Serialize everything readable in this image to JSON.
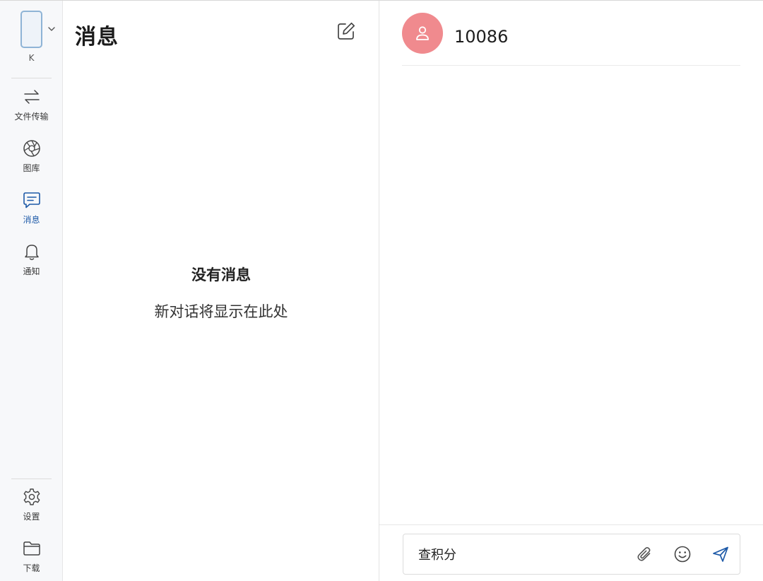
{
  "rail": {
    "device_label": "K",
    "items": [
      {
        "label": "文件传输",
        "icon": "transfer-arrows-icon"
      },
      {
        "label": "图库",
        "icon": "aperture-icon"
      },
      {
        "label": "消息",
        "icon": "message-icon",
        "active": true
      },
      {
        "label": "通知",
        "icon": "bell-icon"
      }
    ],
    "bottom_items": [
      {
        "label": "设置",
        "icon": "gear-icon"
      },
      {
        "label": "下载",
        "icon": "folder-icon"
      }
    ]
  },
  "list": {
    "title": "消息",
    "empty_title": "没有消息",
    "empty_subtitle": "新对话将显示在此处"
  },
  "chat": {
    "contact_name": "10086",
    "composer_value": "查积分"
  },
  "colors": {
    "accent": "#1e5aa8",
    "avatar": "#f08a8e",
    "rail_bg": "#f7f8fa"
  }
}
